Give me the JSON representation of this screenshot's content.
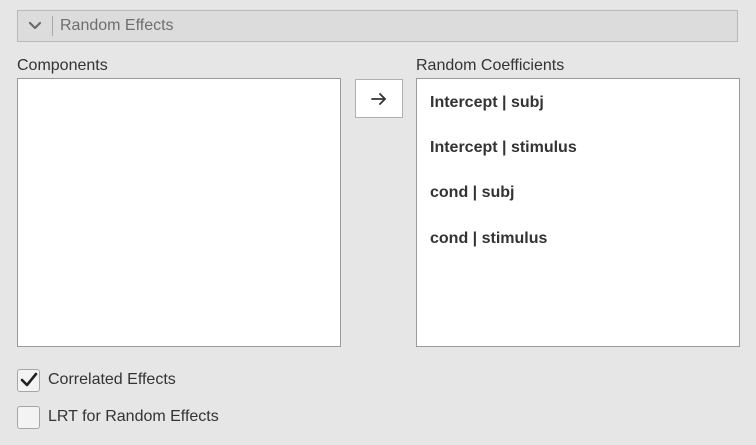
{
  "section": {
    "title": "Random Effects",
    "collapse_icon": "chevron-down-icon"
  },
  "components": {
    "label": "Components",
    "items": []
  },
  "transfer_button": {
    "icon": "arrow-right-icon"
  },
  "random_coefficients": {
    "label": "Random Coefficients",
    "items": [
      "Intercept | subj",
      "Intercept | stimulus",
      "cond | subj",
      "cond | stimulus"
    ]
  },
  "options": {
    "correlated_effects": {
      "label": "Correlated Effects",
      "checked": true
    },
    "lrt_random_effects": {
      "label": "LRT for Random Effects",
      "checked": false
    }
  }
}
